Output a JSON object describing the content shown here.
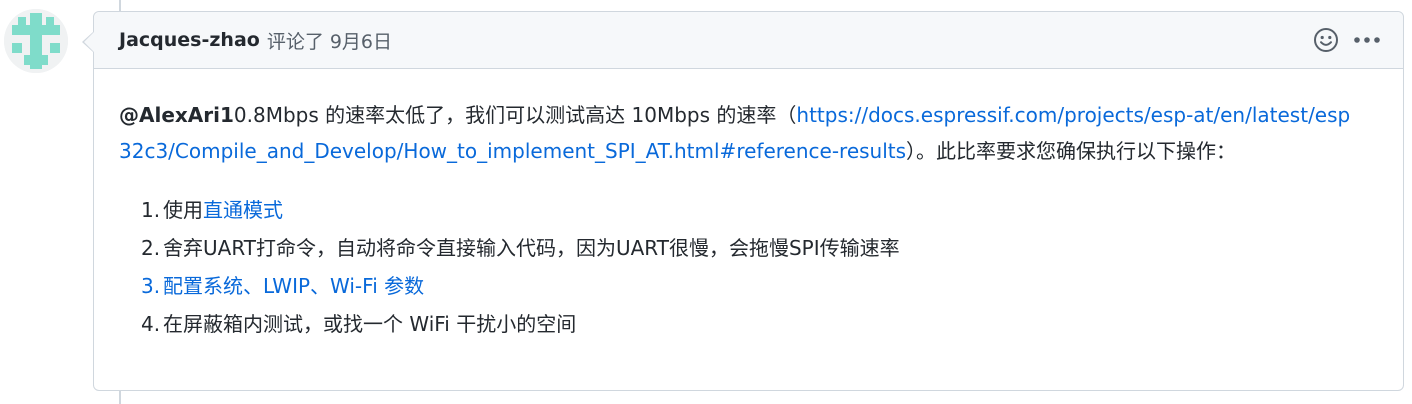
{
  "comment": {
    "author": "Jacques-zhao",
    "action": "评论了",
    "date": "9月6日",
    "avatar_icon": "identicon-avatar",
    "actions": {
      "emoji_icon": "smiley-icon",
      "more_icon": "kebab-horizontal-icon"
    },
    "body": {
      "mention": "@AlexAri1",
      "text_before_link": "0.8Mbps 的速率太低了，我们可以测试高达 10Mbps 的速率（",
      "link": "https://docs.espressif.com/projects/esp-at/en/latest/esp32c3/Compile_and_Develop/How_to_implement_SPI_AT.html#reference-results",
      "text_after_link": "）。此比率要求您确保执行以下操作："
    },
    "steps": [
      {
        "num": "1.",
        "prefix": "使用 ",
        "link_text": "直通模式",
        "suffix": ""
      },
      {
        "num": "2.",
        "prefix": "舍弃UART打命令，自动将命令直接输入代码，因为UART很慢，会拖慢SPI传输速率",
        "link_text": "",
        "suffix": ""
      },
      {
        "num": "3.",
        "prefix": "",
        "link_text": "配置系统、LWIP、Wi-Fi 参数",
        "suffix": ""
      },
      {
        "num": "4.",
        "prefix": "在屏蔽箱内测试，或找一个 WiFi 干扰小的空间",
        "link_text": "",
        "suffix": ""
      }
    ]
  },
  "colors": {
    "link": "#0969da",
    "text": "#24292f",
    "muted": "#57606a",
    "border": "#d0d7de",
    "header_bg": "#f6f8fa",
    "avatar_fg": "#7fdcca"
  }
}
